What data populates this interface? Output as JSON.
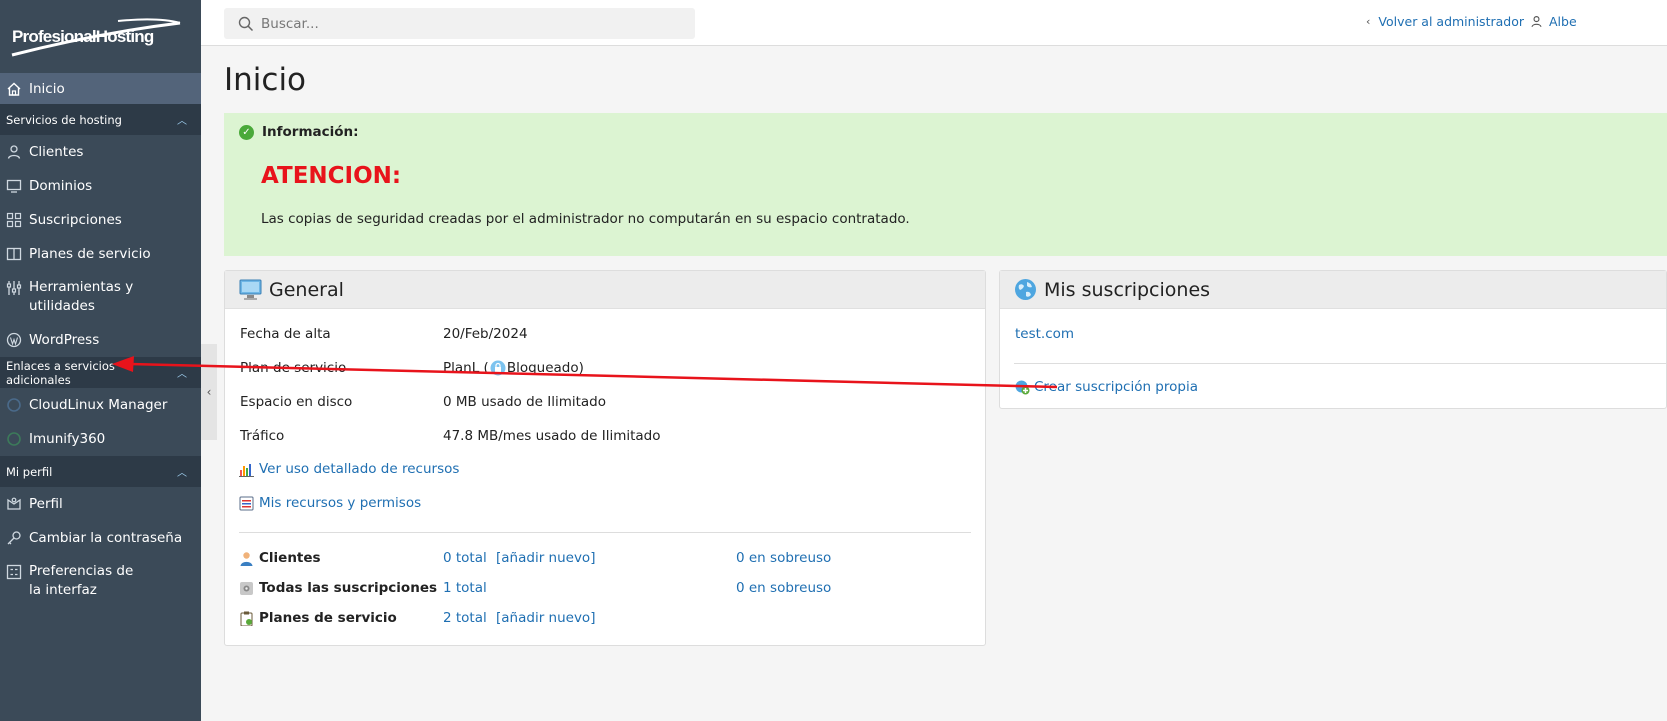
{
  "brand": {
    "logo_text": "ProfesionalHosting"
  },
  "search": {
    "placeholder": "Buscar..."
  },
  "header": {
    "back_label": "Volver al administrador",
    "user_label": "Albe"
  },
  "sidebar": {
    "home": "Inicio",
    "sections": [
      {
        "title": "Servicios de hosting",
        "items": [
          "Clientes",
          "Dominios",
          "Suscripciones",
          "Planes de servicio",
          "Herramientas y utilidades",
          "WordPress"
        ]
      },
      {
        "title": "Enlaces a servicios adicionales",
        "items": [
          "CloudLinux Manager",
          "Imunify360"
        ]
      },
      {
        "title": "Mi perfil",
        "items": [
          "Perfil",
          "Cambiar la contraseña",
          "Preferencias de la interfaz"
        ]
      }
    ]
  },
  "page": {
    "title": "Inicio"
  },
  "info": {
    "heading": "Información:",
    "alert": "ATENCION:",
    "text": "Las copias de seguridad creadas por el administrador no computarán en su espacio contratado."
  },
  "general": {
    "title": "General",
    "rows": [
      {
        "label": "Fecha de alta",
        "value": "20/Feb/2024"
      },
      {
        "label": "Plan de servicio",
        "value_prefix": "PlanL (",
        "value_suffix": " Bloqueado)"
      },
      {
        "label": "Espacio en disco",
        "value": "0 MB usado de Ilimitado"
      },
      {
        "label": "Tráfico",
        "value": "47.8 MB/mes usado de Ilimitado"
      }
    ],
    "links": [
      "Ver uso detallado de recursos",
      "Mis recursos y permisos"
    ],
    "stats": [
      {
        "label": "Clientes",
        "total": "0 total",
        "add": "[añadir nuevo]",
        "over": "0 en sobreuso"
      },
      {
        "label": "Todas las suscripciones",
        "total": "1 total",
        "add": "",
        "over": "0 en sobreuso"
      },
      {
        "label": "Planes de servicio",
        "total": "2 total",
        "add": "[añadir nuevo]",
        "over": ""
      }
    ]
  },
  "subscriptions": {
    "title": "Mis suscripciones",
    "items": [
      "test.com"
    ],
    "create_label": "Crear suscripción propia"
  },
  "colors": {
    "sidebar": "#3b4a58",
    "accent": "#1f6fb2",
    "alert": "#e8131b",
    "info_bg": "#dcf4d2",
    "annotation_arrow": "#e8131b"
  }
}
